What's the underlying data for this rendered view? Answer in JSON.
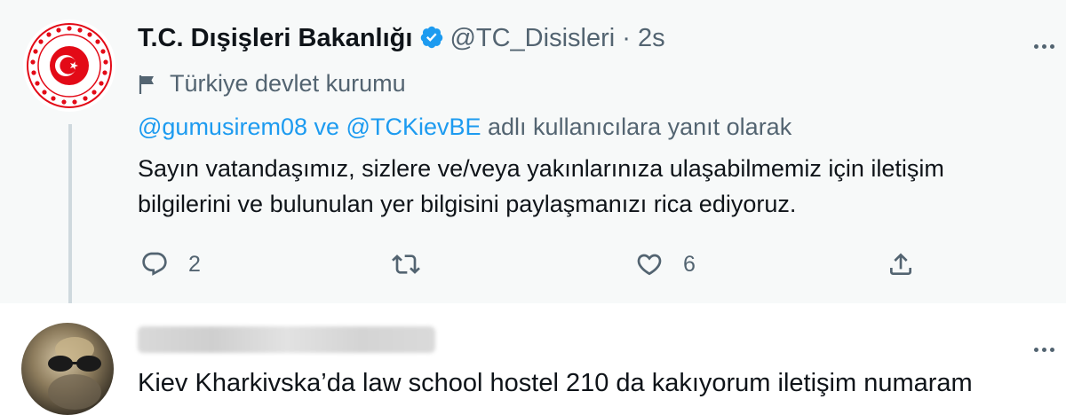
{
  "tweet": {
    "display_name": "T.C. Dışişleri Bakanlığı",
    "handle": "@TC_Disisleri",
    "separator": "·",
    "time": "2s",
    "account_label": "Türkiye devlet kurumu",
    "reply_to": {
      "mention1": "@gumusirem08",
      "connector": "ve",
      "mention2": "@TCKievBE",
      "suffix": "adlı kullanıcılara yanıt olarak"
    },
    "text": "Sayın vatandaşımız, sizlere ve/veya yakınlarınıza ulaşabilmemiz için iletişim bilgilerini ve bulunulan yer bilgisini paylaşmanızı rica ediyoruz.",
    "reply_count": "2",
    "retweet_count": "",
    "like_count": "6",
    "icons": [
      "reply-icon",
      "retweet-icon",
      "like-icon",
      "share-icon",
      "verified-badge-icon",
      "flag-icon",
      "more-icon"
    ]
  },
  "reply_tweet": {
    "text": "Kiev Kharkivska’da law school hostel 210 da kakıyorum iletişim numaram"
  },
  "colors": {
    "accent": "#1d9bf0",
    "secondary_text": "#536471",
    "background_highlight": "#f7f9f9",
    "seal_red": "#e30a17"
  }
}
